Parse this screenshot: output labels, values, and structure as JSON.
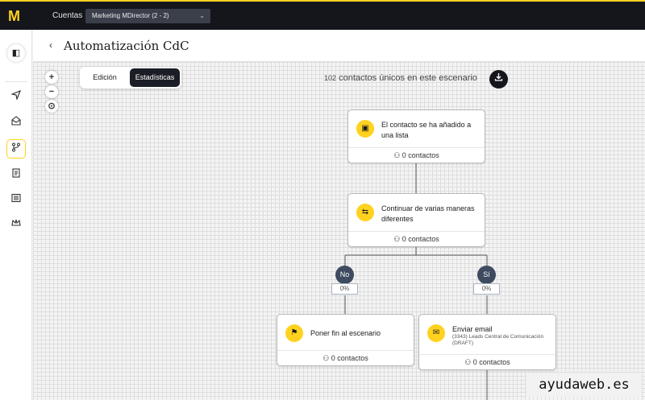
{
  "topbar": {
    "logo_letter": "M",
    "accounts_label": "Cuentas",
    "account_selected": "Marketing MDirector (2 - 2)",
    "accent_color": "#ffd21f"
  },
  "sidebar": {
    "items": [
      {
        "icon": "send-icon"
      },
      {
        "icon": "mail-open-icon"
      },
      {
        "icon": "branch-icon",
        "active": true
      },
      {
        "icon": "document-icon"
      },
      {
        "icon": "list-icon"
      },
      {
        "icon": "crown-icon"
      }
    ]
  },
  "header": {
    "title": "Automatización CdC"
  },
  "modes": {
    "edit_label": "Edición",
    "stats_label": "Estadísticas"
  },
  "zoom": {
    "plus": "+",
    "minus": "−"
  },
  "stats": {
    "count": "102",
    "text": "contactos únicos en este escenario"
  },
  "nodes": {
    "trigger": {
      "title": "El contacto se ha añadido a una lista",
      "footer": "0 contactos"
    },
    "split": {
      "title": "Continuar de varias maneras diferentes",
      "footer": "0 contactos"
    },
    "end": {
      "title": "Poner fin al escenario",
      "footer": "0 contactos"
    },
    "email": {
      "title": "Enviar email",
      "subtitle": "(3343) Leads Central de Comunicación (DRAFT)",
      "footer": "0 contactos"
    }
  },
  "branches": {
    "no": {
      "label": "No",
      "percent": "0%"
    },
    "yes": {
      "label": "Sí",
      "percent": "0%"
    }
  },
  "watermark": "ayudaweb.es"
}
